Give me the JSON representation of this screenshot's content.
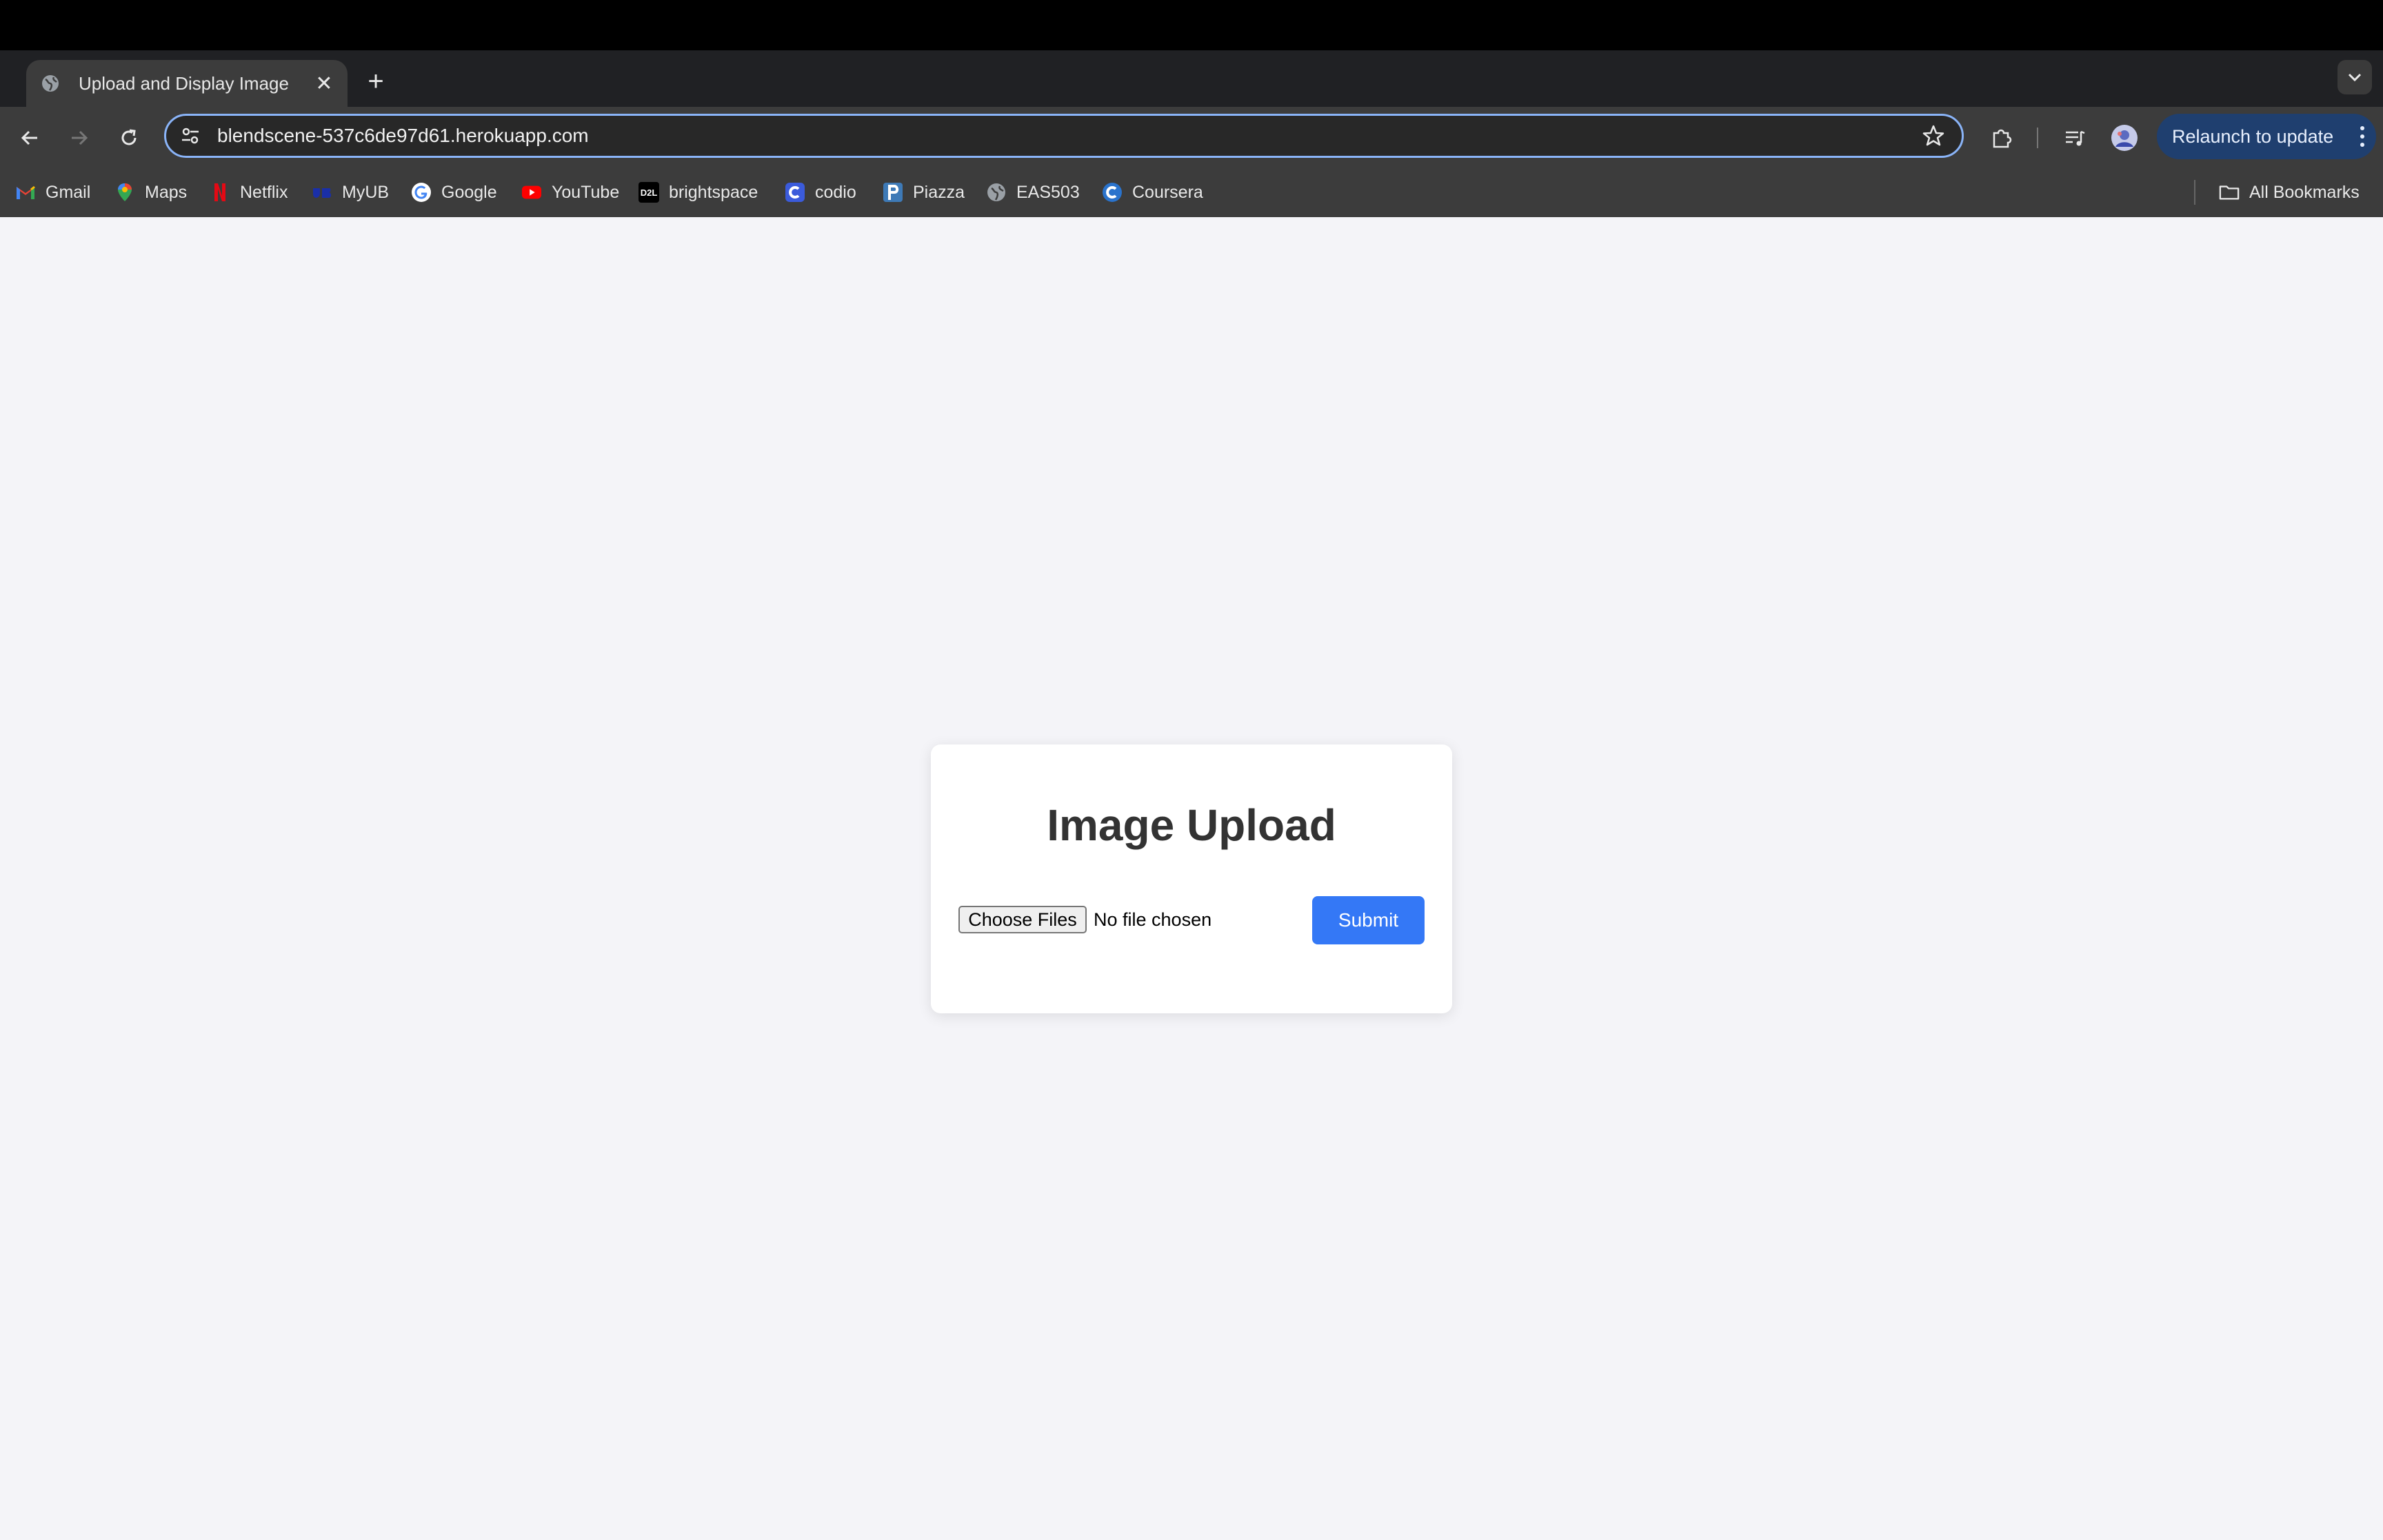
{
  "browser": {
    "tab": {
      "title": "Upload and Display Image",
      "close_glyph": "✕",
      "favicon": "globe-icon"
    },
    "new_tab_glyph": "+",
    "tab_search_glyph": "⌄",
    "address": {
      "url": "blendscene-537c6de97d61.herokuapp.com"
    },
    "relaunch_label": "Relaunch to update",
    "bookmarks": [
      {
        "label": "Gmail",
        "icon": "gmail-icon"
      },
      {
        "label": "Maps",
        "icon": "maps-icon"
      },
      {
        "label": "Netflix",
        "icon": "netflix-icon"
      },
      {
        "label": "MyUB",
        "icon": "myub-icon"
      },
      {
        "label": "Google",
        "icon": "google-icon"
      },
      {
        "label": "YouTube",
        "icon": "youtube-icon"
      },
      {
        "label": "brightspace",
        "icon": "d2l-icon"
      },
      {
        "label": "codio",
        "icon": "codio-icon"
      },
      {
        "label": "Piazza",
        "icon": "piazza-icon"
      },
      {
        "label": "EAS503",
        "icon": "globe-icon"
      },
      {
        "label": "Coursera",
        "icon": "coursera-icon"
      }
    ],
    "all_bookmarks_label": "All Bookmarks",
    "d2l_icon_text": "D2L"
  },
  "page": {
    "title": "Image Upload",
    "choose_files_label": "Choose Files",
    "no_file_text": "No file chosen",
    "submit_label": "Submit",
    "accent_color": "#3478f6"
  }
}
